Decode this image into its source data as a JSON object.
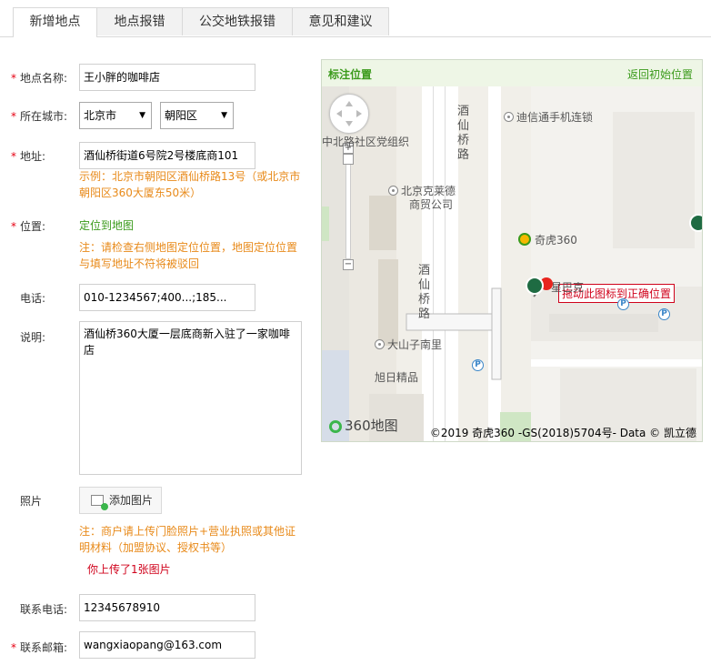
{
  "tabs": [
    {
      "label": "新增地点",
      "active": true
    },
    {
      "label": "地点报错",
      "active": false
    },
    {
      "label": "公交地铁报错",
      "active": false
    },
    {
      "label": "意见和建议",
      "active": false
    }
  ],
  "form": {
    "required_mark": "*",
    "name": {
      "label": "地点名称:",
      "value": "王小胖的咖啡店"
    },
    "city": {
      "label": "所在城市:",
      "city_value": "北京市",
      "district_value": "朝阳区"
    },
    "address": {
      "label": "地址:",
      "value": "酒仙桥街道6号院2号楼底商101",
      "hint_line1": "示例：北京市朝阳区酒仙桥路13号（或北京市",
      "hint_line2": "朝阳区360大厦东50米）"
    },
    "position": {
      "label": "位置:",
      "link": "定位到地图",
      "hint_line1": "注：请检查右侧地图定位位置，地图定位位置",
      "hint_line2": "与填写地址不符将被驳回"
    },
    "phone": {
      "label": "电话:",
      "value": "010-1234567;400...;185..."
    },
    "desc": {
      "label": "说明:",
      "value": "酒仙桥360大厦一层底商新入驻了一家咖啡店"
    },
    "photo": {
      "label": "照片",
      "button": "添加图片",
      "hint_line1": "注：商户请上传门脸照片+营业执照或其他证",
      "hint_line2": "明材料（加盟协议、授权书等）",
      "uploaded": "你上传了1张图片"
    },
    "contact_phone": {
      "label": "联系电话:",
      "value": "12345678910"
    },
    "contact_email": {
      "label": "联系邮箱:",
      "value": "wangxiaopang@163.com"
    }
  },
  "map": {
    "title": "标注位置",
    "back": "返回初始位置",
    "tip": "拖动此图标到正确位置",
    "labels": {
      "dishin": "迪信通手机连锁",
      "community": "中北路社区党组织",
      "kelaide": "北京克莱德",
      "kelaide2": "商贸公司",
      "qihu": "奇虎360",
      "starbucks": "星巴克",
      "dashanzi": "大山子南里",
      "xuri": "旭日精品",
      "road1": [
        "酒",
        "仙",
        "桥",
        "路"
      ],
      "road2": [
        "酒",
        "仙",
        "桥",
        "路"
      ]
    },
    "logo": "360地图",
    "copyright": "©2019 奇虎360 -GS(2018)5704号- Data © 凯立德",
    "zoom_in": "+",
    "zoom_out": "−",
    "park": "P"
  },
  "colors": {
    "required": "#e60012",
    "hint": "#e88a1a",
    "accent": "#3a9a1a",
    "error": "#d0021b"
  }
}
